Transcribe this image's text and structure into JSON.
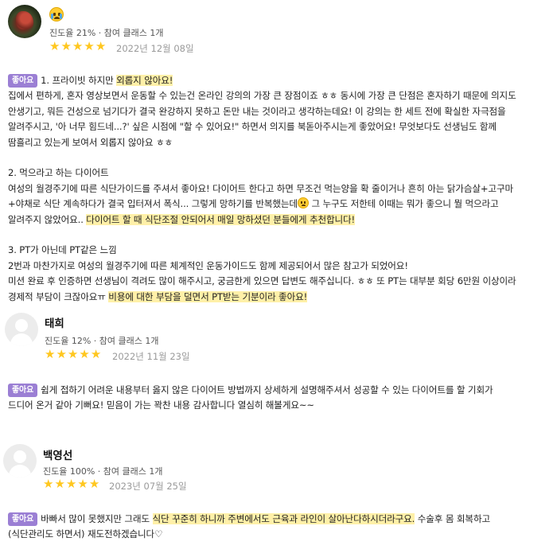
{
  "reviews": [
    {
      "name": "",
      "meta": "진도율 21% · 참여 클래스 1개",
      "rating": 5,
      "date": "2022년 12월 08일",
      "badge": "좋아요",
      "lines": [
        [
          {
            "t": "1. 프라이빗 하지만 "
          },
          {
            "t": "외롭지 않아요!",
            "hl": true
          }
        ],
        [
          {
            "t": "집에서 편하게, 혼자 영상보면서 운동할 수 있는건 온라인 강의의 가장 큰 장점이죠 ㅎㅎ 동시에 가장 큰 단점은 혼자하기 때문에 의지도"
          }
        ],
        [
          {
            "t": "안생기고, 뭐든 건성으로 넘기다가 결국 완강하지 못하고 돈만 내는 것이라고 생각하는데요! 이 강의는 한 세트 전에 확실한 자극점을"
          }
        ],
        [
          {
            "t": "알려주시고, '아 너무 힘드네...?' 싶은 시점에 \"할 수 있어요!\" 하면서 의지를 북돋아주시는게 좋았어요!  무엇보다도 선생님도 함께"
          }
        ],
        [
          {
            "t": "땀흘리고 있는게 보여서 외롭지 않아요 ㅎㅎ"
          }
        ],
        [],
        [
          {
            "t": "2. 먹으라고 하는 다이어트"
          }
        ],
        [
          {
            "t": "여성의 월경주기에 따른 식단가이드를 주셔서 좋아요! 다이어트 한다고 하면 무조건 먹는양을 확 줄이거나 흔히 아는 닭가슴살+고구마"
          }
        ],
        [
          {
            "t": "+야채로 식단 계속하다가 결국 입터져서 폭식... 그렇게 망하기를 반복했는데"
          },
          {
            "emoji": "crying-face"
          },
          {
            "t": " 그 누구도 저한테 이때는 뭐가 좋으니 뭘 먹으라고"
          }
        ],
        [
          {
            "t": "알려주지 않았어요.. "
          },
          {
            "t": "다이어트 할 때 식단조절 안되어서 매일 망하셨던 분들에게 추천합니다!",
            "hl": true
          }
        ],
        [],
        [
          {
            "t": "3. PT가 아닌데 PT같은 느낌"
          }
        ],
        [
          {
            "t": "2번과 마찬가지로 여성의 월경주기에 따른 체계적인 운동가이드도 함께 제공되어서 많은 참고가 되었어요!"
          }
        ],
        [
          {
            "t": "미션 완료 후 인증하면 선생님이 격려도 많이 해주시고, 궁금한게 있으면 답변도 해주십니다. ㅎㅎ 또 PT는 대부분 회당 6만원 이상이라"
          }
        ],
        [
          {
            "t": "경제적 부담이 크잖아요ㅠ "
          },
          {
            "t": "비용에 대한 부담을 덜면서 PT받는 기분이라 좋아요!",
            "hl": true
          }
        ]
      ]
    },
    {
      "name": "태희",
      "meta": "진도율 12% · 참여 클래스 1개",
      "rating": 5,
      "date": "2022년 11월 23일",
      "badge": "좋아요",
      "lines": [
        [
          {
            "t": "쉽게 접하기 어려운 내용부터 옳지 않은 다이어트 방법까지 상세하게 설명해주셔서 성공할 수 있는 다이어트를 할 기회가"
          }
        ],
        [
          {
            "t": "드디어 온거 같아 기뻐요! 믿음이 가는 꽉찬 내용 감사합니다 열심히 해볼게요~~"
          }
        ]
      ]
    },
    {
      "name": "백영선",
      "meta": "진도율 100% · 참여 클래스 1개",
      "rating": 5,
      "date": "2023년 07월 25일",
      "badge": "좋아요",
      "lines": [
        [
          {
            "t": "바빠서 많이 못했지만 그래도 "
          },
          {
            "t": "식단 꾸준히 하니까 주변에서도 근육과 라인이 살아난다하시더라구요.",
            "hl": true
          },
          {
            "t": " 수술후 몸 회복하고"
          }
        ],
        [
          {
            "t": "(식단관리도 하면서) 재도전하겠습니다♡"
          }
        ]
      ]
    }
  ]
}
